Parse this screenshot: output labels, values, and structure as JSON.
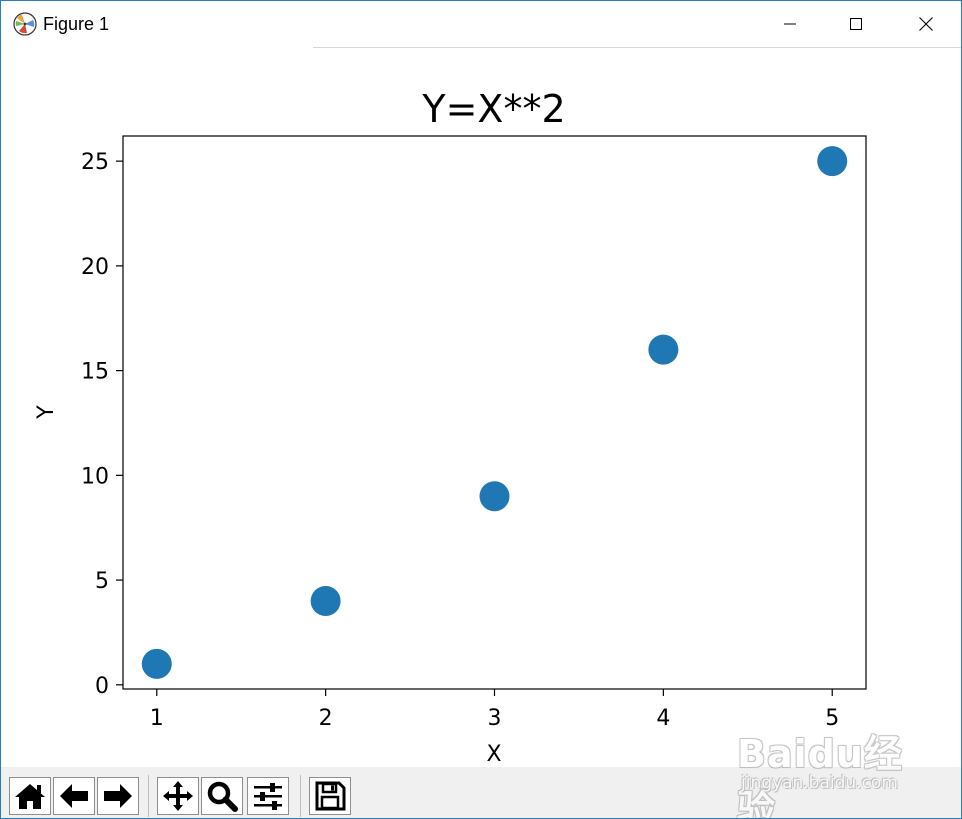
{
  "window": {
    "title": "Figure 1",
    "icons": {
      "app": "matplotlib-icon",
      "minimize": "minimize-icon",
      "maximize": "maximize-icon",
      "close": "close-icon"
    }
  },
  "chart_data": {
    "type": "scatter",
    "title": "Y=X**2",
    "xlabel": "X",
    "ylabel": "Y",
    "x": [
      1,
      2,
      3,
      4,
      5
    ],
    "y": [
      1,
      4,
      9,
      16,
      25
    ],
    "xlim": [
      0.8,
      5.2
    ],
    "ylim": [
      -0.2,
      26.2
    ],
    "xticks": [
      1,
      2,
      3,
      4,
      5
    ],
    "yticks": [
      0,
      5,
      10,
      15,
      20,
      25
    ],
    "xtick_labels": [
      "1",
      "2",
      "3",
      "4",
      "5"
    ],
    "ytick_labels": [
      "0",
      "5",
      "10",
      "15",
      "20",
      "25"
    ],
    "marker_color": "#1f77b4",
    "grid": false
  },
  "toolbar": {
    "buttons": [
      {
        "name": "home",
        "icon": "home-icon"
      },
      {
        "name": "back",
        "icon": "arrow-left-icon"
      },
      {
        "name": "forward",
        "icon": "arrow-right-icon"
      },
      {
        "name": "pan",
        "icon": "move-icon"
      },
      {
        "name": "zoom",
        "icon": "magnifier-icon"
      },
      {
        "name": "configure-subplots",
        "icon": "sliders-icon"
      },
      {
        "name": "save",
        "icon": "floppy-disk-icon"
      }
    ]
  },
  "watermark": {
    "brand": "Baidu经验",
    "sub": "jingyan.baidu.com"
  }
}
